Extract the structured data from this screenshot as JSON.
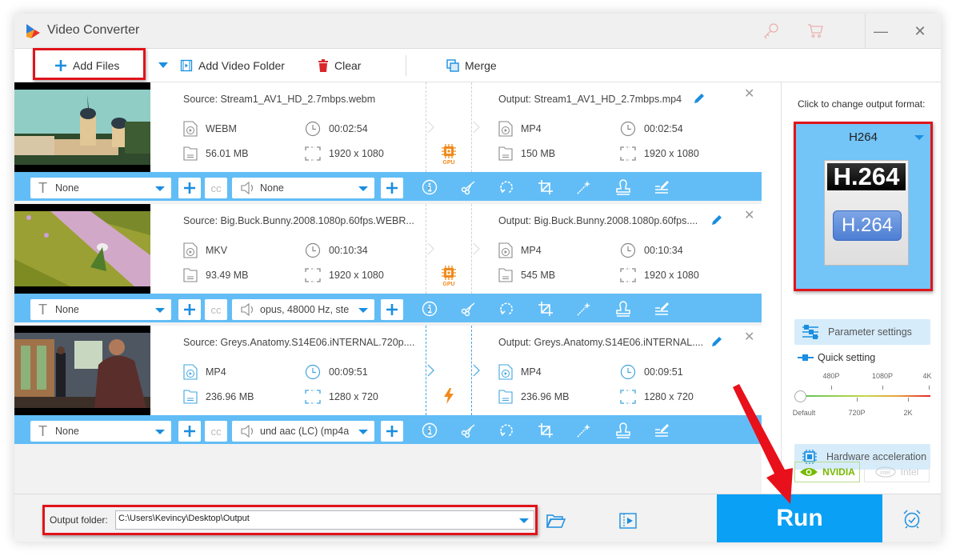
{
  "app": {
    "title": "Video Converter",
    "titlebar_icons": [
      "key-icon",
      "cart-icon"
    ],
    "window_buttons": {
      "minimize": "—",
      "close": "✕"
    }
  },
  "toolbar": {
    "add_files": "Add Files",
    "add_video_folder": "Add Video Folder",
    "clear": "Clear",
    "merge": "Merge"
  },
  "items": [
    {
      "source": "Source: Stream1_AV1_HD_2.7mbps.webm",
      "src_format": "WEBM",
      "src_duration": "00:02:54",
      "src_size": "56.01 MB",
      "src_resolution": "1920 x 1080",
      "output": "Output: Stream1_AV1_HD_2.7mbps.mp4",
      "out_format": "MP4",
      "out_duration": "00:02:54",
      "out_size": "150 MB",
      "out_resolution": "1920 x 1080",
      "accel": "GPU",
      "subtitle": "None",
      "audio": "None",
      "thumbnail": "church-scene"
    },
    {
      "source": "Source: Big.Buck.Bunny.2008.1080p.60fps.WEBR...",
      "src_format": "MKV",
      "src_duration": "00:10:34",
      "src_size": "93.49 MB",
      "src_resolution": "1920 x 1080",
      "output": "Output: Big.Buck.Bunny.2008.1080p.60fps....",
      "out_format": "MP4",
      "out_duration": "00:10:34",
      "out_size": "545 MB",
      "out_resolution": "1920 x 1080",
      "accel": "GPU",
      "subtitle": "None",
      "audio": "opus, 48000 Hz, ste",
      "thumbnail": "grass-scene"
    },
    {
      "source": "Source: Greys.Anatomy.S14E06.iNTERNAL.720p....",
      "src_format": "MP4",
      "src_duration": "00:09:51",
      "src_size": "236.96 MB",
      "src_resolution": "1280 x 720",
      "output": "Output: Greys.Anatomy.S14E06.iNTERNAL....",
      "out_format": "MP4",
      "out_duration": "00:09:51",
      "out_size": "236.96 MB",
      "out_resolution": "1280 x 720",
      "accel": "lightning",
      "subtitle": "None",
      "audio": "und aac (LC) (mp4a",
      "thumbnail": "room-scene"
    }
  ],
  "bar_icons": [
    "info-icon",
    "scissors-icon",
    "rotate-icon",
    "crop-icon",
    "effects-wand-icon",
    "watermark-stamp-icon",
    "edit-subtitle-icon"
  ],
  "sidebar": {
    "change_format_label": "Click to change output format:",
    "format_name": "H264",
    "format_card_top": "H.264",
    "format_card_pill": "H.264",
    "parameter_settings": "Parameter settings",
    "quick_setting": "Quick setting",
    "slider_top_labels": [
      "480P",
      "1080P",
      "4K"
    ],
    "slider_bottom_labels": [
      "Default",
      "720P",
      "2K"
    ],
    "slider_value": "Default",
    "hardware_acceleration": "Hardware acceleration",
    "nvidia": "NVIDIA",
    "intel": "Intel"
  },
  "bottom": {
    "output_folder_label": "Output folder:",
    "output_folder_value": "C:\\Users\\Kevincy\\Desktop\\Output",
    "run": "Run"
  },
  "colors": {
    "accent": "#0aa0f5",
    "bar": "#62bdf6",
    "highlight": "#e0141b",
    "gpu": "#f08a1c"
  }
}
